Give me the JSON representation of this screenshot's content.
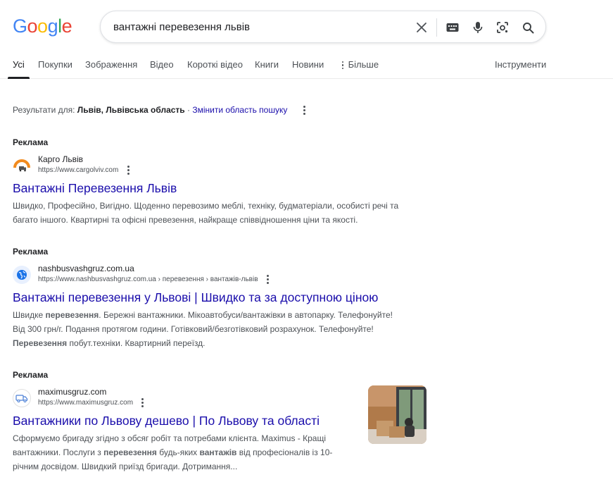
{
  "logo": {
    "letters": [
      "G",
      "o",
      "o",
      "g",
      "l",
      "e"
    ],
    "colors": [
      "#4285F4",
      "#EA4335",
      "#FBBC05",
      "#4285F4",
      "#34A853",
      "#EA4335"
    ]
  },
  "search": {
    "query": "вантажні перевезення львів"
  },
  "tabs": [
    {
      "label": "Усі",
      "active": true
    },
    {
      "label": "Покупки"
    },
    {
      "label": "Зображення"
    },
    {
      "label": "Відео"
    },
    {
      "label": "Короткі відео"
    },
    {
      "label": "Книги"
    },
    {
      "label": "Новини"
    },
    {
      "label": "Більше"
    }
  ],
  "tools_label": "Інструменти",
  "region": {
    "prefix": "Результати для:",
    "location": "Львів, Львівська область",
    "separator": "·",
    "change_link": "Змінити область пошуку"
  },
  "ads": [
    {
      "label": "Реклама",
      "site_name": "Карго Львів",
      "url": "https://www.cargolviv.com",
      "title": "Вантажні Перевезення Львів",
      "desc_lines": [
        "Швидко, Професійно, Вигідно. Щоденно перевозимо меблі, техніку, будматеріали, особисті речі та",
        "багато іншого. Квартирні та офісні превезення, найкраще співвідношення ціни та якості."
      ]
    },
    {
      "label": "Реклама",
      "site_name": "nashbusvashgruz.com.ua",
      "url": "https://www.nashbusvashgruz.com.ua › перевезення › вантажів-львів",
      "title": "Вантажні перевезення у Львові | Швидко та за доступною ціною",
      "desc_parts": [
        {
          "t": "Швидке "
        },
        {
          "t": "перевезення",
          "b": true
        },
        {
          "t": ". Бережні вантажники. Мікоавтобуси/вантажівки в автопарку. Телефонуйте!"
        },
        {
          "br": true
        },
        {
          "t": "Від 300 грн/г. Подання протягом години. Готівковий/безготівковий розрахунок. Телефонуйте!"
        },
        {
          "br": true
        },
        {
          "t": "Перевезення",
          "b": true
        },
        {
          "t": " побут.техніки. Квартирний переїзд."
        }
      ]
    },
    {
      "label": "Реклама",
      "site_name": "maximusgruz.com",
      "url": "https://www.maximusgruz.com",
      "title": "Вантажники по Львову дешево | По Львову та області",
      "desc_parts": [
        {
          "t": "Сформуємо бригаду згідно з обсяг робіт та потребами клієнта. Maximus - Кращі"
        },
        {
          "br": true
        },
        {
          "t": "вантажники. Послуги з "
        },
        {
          "t": "перевезення",
          "b": true
        },
        {
          "t": " будь-яких "
        },
        {
          "t": "вантажів",
          "b": true
        },
        {
          "t": " від професіоналів із 10-"
        },
        {
          "br": true
        },
        {
          "t": "річним досвідом. Швидкий приїзд бригади. Дотримання..."
        }
      ]
    }
  ]
}
